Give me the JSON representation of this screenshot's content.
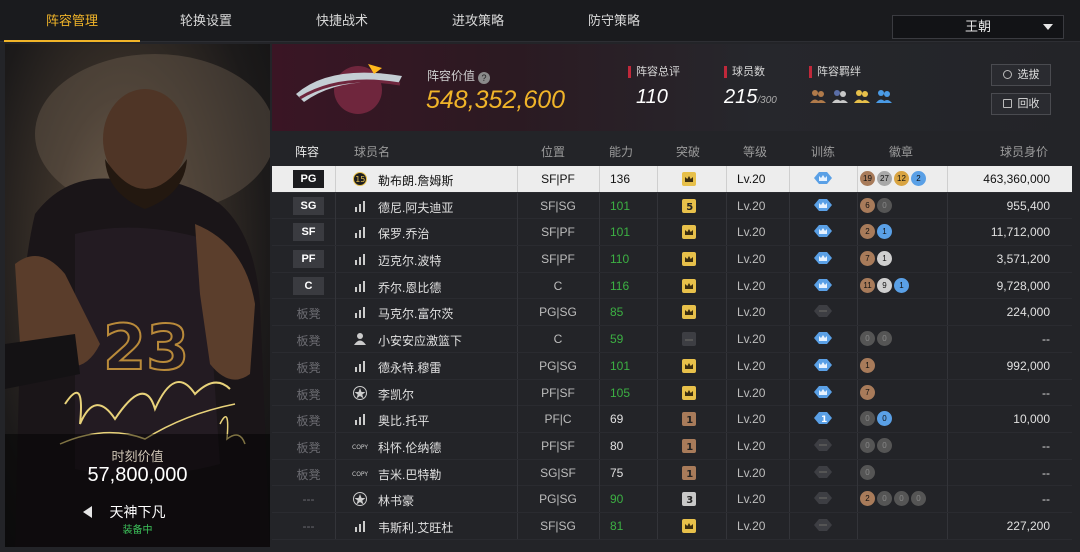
{
  "tabs": [
    {
      "label": "阵容管理",
      "active": true
    },
    {
      "label": "轮换设置"
    },
    {
      "label": "快捷战术"
    },
    {
      "label": "进攻策略"
    },
    {
      "label": "防守策略"
    }
  ],
  "lineup_select": {
    "value": "王朝"
  },
  "card": {
    "value_label": "时刻价值",
    "value": "57,800,000",
    "name": "天神下凡",
    "status": "装备中"
  },
  "header": {
    "value_label": "阵容价值",
    "value": "548,352,600",
    "rating_label": "阵容总评",
    "rating": "110",
    "count_label": "球员数",
    "count": "215",
    "count_max": "/300",
    "bond_label": "阵容羁绊",
    "filter_label": "选拔",
    "recycle_label": "回收"
  },
  "columns": [
    "阵容",
    "球员名",
    "位置",
    "能力",
    "突破",
    "等级",
    "训练",
    "徽章",
    "球员身价"
  ],
  "colors": {
    "accent": "#f0b429",
    "green": "#3cb043",
    "team": "#6f263d"
  },
  "rows": [
    {
      "slot": "PG",
      "starter": true,
      "player_icon": "number-15-icon",
      "jersey": "15",
      "name": "勒布朗.詹姆斯",
      "pos": "SF|PF",
      "ability": "136",
      "ability_green": false,
      "breakthrough": "crown",
      "level": "Lv.20",
      "train": "crown",
      "badges": [
        [
          "19",
          "#a87b5a"
        ],
        [
          "27",
          "#a8a8a8"
        ],
        [
          "12",
          "#d9a441"
        ],
        [
          "2",
          "#5aa0e6"
        ]
      ],
      "value": "463,360,000"
    },
    {
      "slot": "SG",
      "starter": true,
      "player_icon": "signal-icon",
      "name": "德尼.阿夫迪亚",
      "pos": "SF|SG",
      "ability": "101",
      "ability_green": true,
      "breakthrough": "5",
      "level": "Lv.20",
      "train": "crown",
      "badges": [
        [
          "6",
          "#a87b5a"
        ],
        [
          "0",
          "#555"
        ]
      ],
      "value": "955,400"
    },
    {
      "slot": "SF",
      "starter": true,
      "player_icon": "signal-icon",
      "name": "保罗.乔治",
      "pos": "SF|PF",
      "ability": "101",
      "ability_green": true,
      "breakthrough": "crown",
      "level": "Lv.20",
      "train": "crown",
      "badges": [
        [
          "2",
          "#a87b5a"
        ],
        [
          "1",
          "#5aa0e6"
        ]
      ],
      "value": "11,712,000"
    },
    {
      "slot": "PF",
      "starter": true,
      "player_icon": "signal-icon",
      "name": "迈克尔.波特",
      "pos": "SF|PF",
      "ability": "110",
      "ability_green": true,
      "breakthrough": "crown",
      "level": "Lv.20",
      "train": "crown",
      "badges": [
        [
          "7",
          "#a87b5a"
        ],
        [
          "1",
          "#cfcfcf"
        ]
      ],
      "value": "3,571,200"
    },
    {
      "slot": "C",
      "starter": true,
      "player_icon": "signal-icon",
      "name": "乔尔.恩比德",
      "pos": "C",
      "ability": "116",
      "ability_green": true,
      "breakthrough": "crown",
      "level": "Lv.20",
      "train": "crown",
      "badges": [
        [
          "11",
          "#a87b5a"
        ],
        [
          "9",
          "#cfcfcf"
        ],
        [
          "1",
          "#5aa0e6"
        ]
      ],
      "value": "9,728,000"
    },
    {
      "slot": "板凳",
      "starter": false,
      "player_icon": "signal-icon",
      "name": "马克尔.富尔茨",
      "pos": "PG|SG",
      "ability": "85",
      "ability_green": true,
      "breakthrough": "crown",
      "level": "Lv.20",
      "train": "dim",
      "badges": [],
      "value": "224,000"
    },
    {
      "slot": "板凳",
      "starter": false,
      "player_icon": "person-icon",
      "name": "小安安应激篮下",
      "pos": "C",
      "ability": "59",
      "ability_green": true,
      "breakthrough": "dim",
      "level": "Lv.20",
      "train": "crown",
      "badges": [
        [
          "0",
          "#555"
        ],
        [
          "0",
          "#555"
        ]
      ],
      "value": "--"
    },
    {
      "slot": "板凳",
      "starter": false,
      "player_icon": "signal-icon",
      "name": "德永特.穆雷",
      "pos": "PG|SG",
      "ability": "101",
      "ability_green": true,
      "breakthrough": "crown",
      "level": "Lv.20",
      "train": "crown",
      "badges": [
        [
          "1",
          "#a87b5a"
        ]
      ],
      "value": "992,000"
    },
    {
      "slot": "板凳",
      "starter": false,
      "player_icon": "star-icon",
      "name": "李凯尔",
      "pos": "PF|SF",
      "ability": "105",
      "ability_green": true,
      "breakthrough": "crown",
      "level": "Lv.20",
      "train": "crown",
      "badges": [
        [
          "7",
          "#a87b5a"
        ]
      ],
      "value": "--"
    },
    {
      "slot": "板凳",
      "starter": false,
      "player_icon": "signal-icon",
      "name": "奥比.托平",
      "pos": "PF|C",
      "ability": "69",
      "ability_green": false,
      "breakthrough": "1",
      "level": "Lv.20",
      "train": "1",
      "badges": [
        [
          "0",
          "#555"
        ],
        [
          "0",
          "#5aa0e6"
        ]
      ],
      "value": "10,000"
    },
    {
      "slot": "板凳",
      "starter": false,
      "player_icon": "copy-icon",
      "name": "科怀.伦纳德",
      "pos": "PF|SF",
      "ability": "80",
      "ability_green": false,
      "breakthrough": "1",
      "level": "Lv.20",
      "train": "dim",
      "badges": [
        [
          "0",
          "#555"
        ],
        [
          "0",
          "#555"
        ]
      ],
      "value": "--"
    },
    {
      "slot": "板凳",
      "starter": false,
      "player_icon": "copy-icon",
      "name": "吉米.巴特勒",
      "pos": "SG|SF",
      "ability": "75",
      "ability_green": false,
      "breakthrough": "1",
      "level": "Lv.20",
      "train": "dim",
      "badges": [
        [
          "0",
          "#555"
        ]
      ],
      "value": "--"
    },
    {
      "slot": "---",
      "starter": false,
      "player_icon": "star-icon",
      "name": "林书豪",
      "pos": "PG|SG",
      "ability": "90",
      "ability_green": true,
      "breakthrough": "3",
      "level": "Lv.20",
      "train": "dim",
      "badges": [
        [
          "2",
          "#a87b5a"
        ],
        [
          "0",
          "#555"
        ],
        [
          "0",
          "#555"
        ],
        [
          "0",
          "#555"
        ]
      ],
      "value": "--"
    },
    {
      "slot": "---",
      "starter": false,
      "player_icon": "signal-icon",
      "name": "韦斯利.艾旺杜",
      "pos": "SF|SG",
      "ability": "81",
      "ability_green": true,
      "breakthrough": "crown",
      "level": "Lv.20",
      "train": "dim",
      "badges": [],
      "value": "227,200"
    }
  ]
}
